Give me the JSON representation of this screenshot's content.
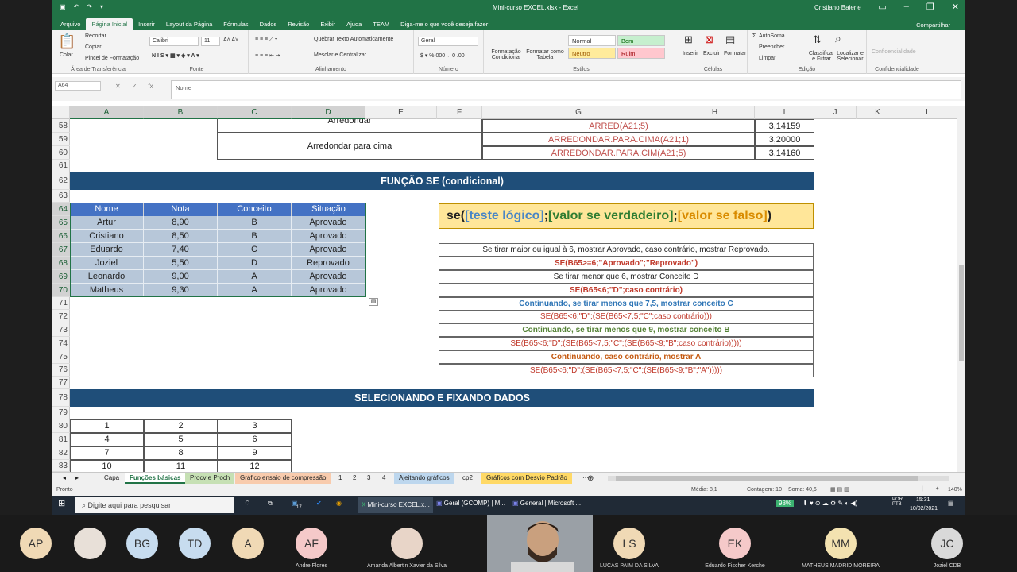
{
  "window": {
    "doc_title": "Mini-curso EXCEL.xlsx  -  Excel",
    "user": "Cristiano Baierle"
  },
  "tabs": [
    "Arquivo",
    "Página Inicial",
    "Inserir",
    "Layout da Página",
    "Fórmulas",
    "Dados",
    "Revisão",
    "Exibir",
    "Ajuda",
    "TEAM",
    "Diga-me o que você deseja fazer"
  ],
  "share": "Compartilhar",
  "ribbon": {
    "clip": {
      "paste": "Colar",
      "cut": "Recortar",
      "copy": "Copiar",
      "painter": "Pincel de Formatação",
      "label": "Área de Transferência"
    },
    "font": {
      "name": "Calibri",
      "size": "11",
      "label": "Fonte"
    },
    "align": {
      "wrap": "Quebrar Texto Automaticamente",
      "merge": "Mesclar e Centralizar",
      "label": "Alinhamento"
    },
    "number": {
      "format": "Geral",
      "label": "Número"
    },
    "styles": {
      "cond": "Formatação Condicional",
      "table": "Formatar como Tabela",
      "normal": "Normal",
      "bom": "Bom",
      "neutro": "Neutro",
      "ruim": "Ruim",
      "label": "Estilos"
    },
    "cells": {
      "insert": "Inserir",
      "delete": "Excluir",
      "format": "Formatar",
      "label": "Células"
    },
    "edit": {
      "autosum": "AutoSoma",
      "fill": "Preencher",
      "clear": "Limpar",
      "sort": "Classificar e Filtrar",
      "find": "Localizar e Selecionar",
      "label": "Edição"
    },
    "conf": {
      "btn": "Confidencialidade",
      "label": "Confidencialidade"
    }
  },
  "namebox": "A64",
  "formula": "Nome",
  "columns": [
    "A",
    "B",
    "C",
    "D",
    "E",
    "F",
    "G",
    "H",
    "I",
    "J",
    "K",
    "L"
  ],
  "rows": [
    "58",
    "59",
    "60",
    "61",
    "62",
    "63",
    "64",
    "65",
    "66",
    "67",
    "68",
    "69",
    "70",
    "71",
    "72",
    "73",
    "74",
    "75",
    "76",
    "77",
    "78",
    "79",
    "80",
    "81",
    "82",
    "83"
  ],
  "top": {
    "r58a": "Arredondar",
    "r59a": "Arredondar para cima",
    "g58": "ARRED(A21;5)",
    "g59": "ARREDONDAR.PARA.CIMA(A21;1)",
    "g60": "ARREDONDAR.PARA.CIM(A21;5)",
    "i58": "3,14159",
    "i59": "3,20000",
    "i60": "3,14160"
  },
  "banner1": "FUNÇÃO SE (condicional)",
  "banner2": "SELECIONANDO E FIXANDO DADOS",
  "table": {
    "headers": [
      "Nome",
      "Nota",
      "Conceito",
      "Situação"
    ],
    "rows": [
      [
        "Artur",
        "8,90",
        "B",
        "Aprovado"
      ],
      [
        "Cristiano",
        "8,50",
        "B",
        "Aprovado"
      ],
      [
        "Eduardo",
        "7,40",
        "C",
        "Aprovado"
      ],
      [
        "Joziel",
        "5,50",
        "D",
        "Reprovado"
      ],
      [
        "Leonardo",
        "9,00",
        "A",
        "Aprovado"
      ],
      [
        "Matheus",
        "9,30",
        "A",
        "Aprovado"
      ]
    ]
  },
  "syntax": {
    "a": "se(",
    "b": "[teste lógico]",
    ";": ";",
    "c": "[valor se verdadeiro]",
    "d": "[valor se falso]",
    "e": ")"
  },
  "explanations": [
    "Se tirar maior ou igual à 6, mostrar Aprovado, caso contrário, mostrar Reprovado.",
    "SE(B65>=6;\"Aprovado\";\"Reprovado\")",
    "Se tirar menor que 6, mostrar Conceito D",
    "SE(B65<6;\"D\";caso contrário)",
    "Continuando, se tirar menos que 7,5, mostrar conceito C",
    "SE(B65<6;\"D\";(SE(B65<7,5;\"C\";caso contrário)))",
    "Continuando, se tirar menos que 9, mostrar conceito B",
    "SE(B65<6;\"D\";(SE(B65<7,5;\"C\";(SE(B65<9;\"B\";caso contrário)))))",
    "Continuando, caso contrário, mostrar A",
    "SE(B65<6;\"D\";(SE(B65<7,5;\"C\";(SE(B65<9;\"B\";\"A\")))))"
  ],
  "nums": [
    [
      "1",
      "2",
      "3"
    ],
    [
      "4",
      "5",
      "6"
    ],
    [
      "7",
      "8",
      "9"
    ],
    [
      "10",
      "11",
      "12"
    ]
  ],
  "sheets": [
    "Capa",
    "Funções básicas",
    "Procv e Proch",
    "Gráfico ensaio de compressão",
    "1",
    "2",
    "3",
    "4",
    "Ajeitando gráficos",
    "cp2",
    "Gráficos com Desvio Padrão"
  ],
  "status": {
    "mode": "Pronto",
    "avg": "Média: 8,1",
    "count": "Contagem: 10",
    "sum": "Soma: 40,6",
    "zoom": "140%"
  },
  "taskbar": {
    "search": "Digite aqui para pesquisar",
    "app1": "Mini-curso EXCEL.x...",
    "app2": "Geral (GCOMP) | M...",
    "app3": "General | Microsoft ...",
    "battery": "98%",
    "lang": "POR PTB",
    "time": "15:31",
    "date": "10/02/2021",
    "badge": "17"
  },
  "participants": [
    {
      "initials": "AP",
      "name": "",
      "color": "#f0d9b5"
    },
    {
      "initials": "",
      "name": "",
      "color": "#e8e0d8"
    },
    {
      "initials": "BG",
      "name": "",
      "color": "#c7dcef"
    },
    {
      "initials": "TD",
      "name": "",
      "color": "#c7dcef"
    },
    {
      "initials": "A",
      "name": "",
      "color": "#f0d9b5"
    },
    {
      "initials": "AF",
      "name": "Andre Flores",
      "color": "#f5c9c9"
    },
    {
      "initials": "",
      "name": "Amanda Albertin Xavier da Silva",
      "color": "#e8d5c8"
    },
    {
      "initials": "LS",
      "name": "LUCAS PAIM DA SILVA",
      "color": "#f0d9b5"
    },
    {
      "initials": "EK",
      "name": "Eduardo Fischer Kerche",
      "color": "#f5c9c9"
    },
    {
      "initials": "MM",
      "name": "MATHEUS MADRID MOREIRA",
      "color": "#f3e2b0"
    },
    {
      "initials": "JC",
      "name": "Joziel CDB",
      "color": "#d9d9d9"
    }
  ]
}
